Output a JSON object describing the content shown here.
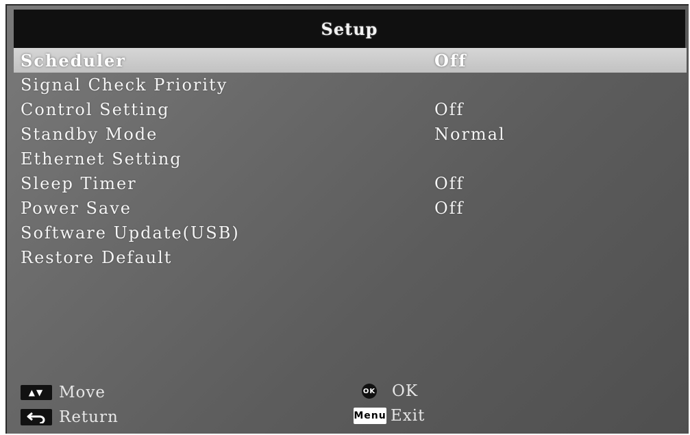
{
  "header": {
    "title": "Setup"
  },
  "menu": {
    "items": [
      {
        "label": "Scheduler",
        "value": "Off",
        "selected": true
      },
      {
        "label": "Signal Check Priority",
        "value": ""
      },
      {
        "label": "Control Setting",
        "value": "Off"
      },
      {
        "label": "Standby Mode",
        "value": "Normal"
      },
      {
        "label": "Ethernet Setting",
        "value": ""
      },
      {
        "label": "Sleep Timer",
        "value": "Off"
      },
      {
        "label": "Power Save",
        "value": "Off"
      },
      {
        "label": "Software Update(USB)",
        "value": ""
      },
      {
        "label": "Restore Default",
        "value": ""
      }
    ]
  },
  "footer": {
    "move_label": "Move",
    "return_label": "Return",
    "ok_label": "OK",
    "ok_key": "OK",
    "exit_label": "Exit",
    "menu_key": "Menu"
  },
  "icons": {
    "move": "up-down-arrows-icon",
    "return": "return-arrow-icon",
    "ok": "ok-button-icon",
    "menu": "menu-key-icon"
  }
}
